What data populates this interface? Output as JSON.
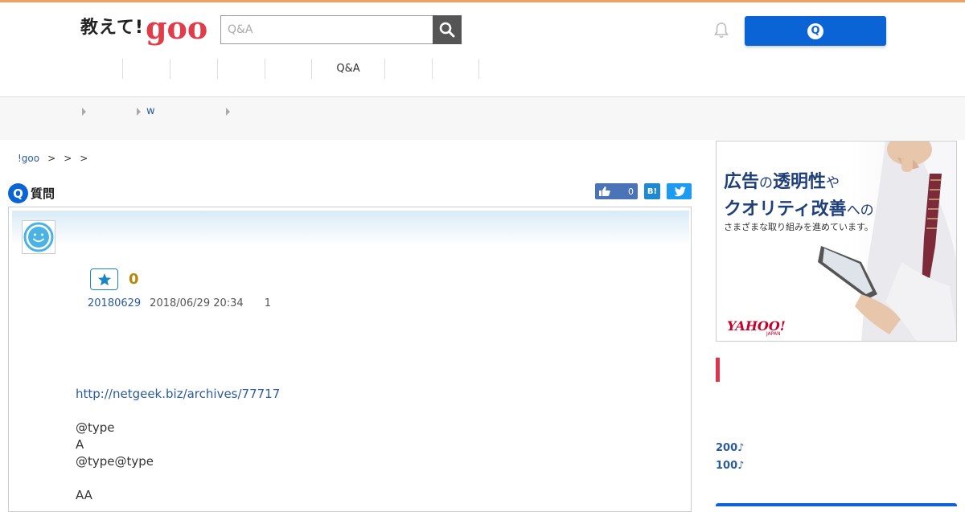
{
  "header": {
    "logo_text": "教えて!",
    "logo_brand": "goo",
    "search_placeholder": "Q&A",
    "ask_button_icon": "Q"
  },
  "nav": {
    "items": [
      "",
      "",
      "",
      "",
      "",
      "Q&A",
      "",
      ""
    ]
  },
  "category_bar": {
    "subcategory": "w"
  },
  "breadcrumb": {
    "home": "!goo",
    "separators": [
      ">",
      ">",
      ">"
    ]
  },
  "question": {
    "section_icon": "Q",
    "section_label": "質問",
    "like_count": "0",
    "hatena_label": "B!",
    "star_count": "0",
    "user": "20180629",
    "datetime": "2018/06/29 20:34",
    "answer_count": "1",
    "body": {
      "link": "http://netgeek.biz/archives/77717",
      "line1": "@type",
      "line2": "A",
      "line3": "@type@type",
      "line4": "AA"
    }
  },
  "ad": {
    "line1_a": "広告",
    "line1_b": "の",
    "line1_c": "透明性",
    "line1_d": "や",
    "line2_a": "クオリティ改善",
    "line2_b": "への",
    "line3": "さまざまな取り組みを進めています。",
    "brand": "YAHOO!",
    "brand_sub": "JAPAN"
  },
  "sidebar": {
    "points_1": "200♪",
    "points_2": "100♪"
  },
  "colors": {
    "accent_blue": "#0a64d6",
    "goo_red": "#e03c4a",
    "link_blue": "#2a5b9e",
    "top_orange": "#f0a060"
  }
}
